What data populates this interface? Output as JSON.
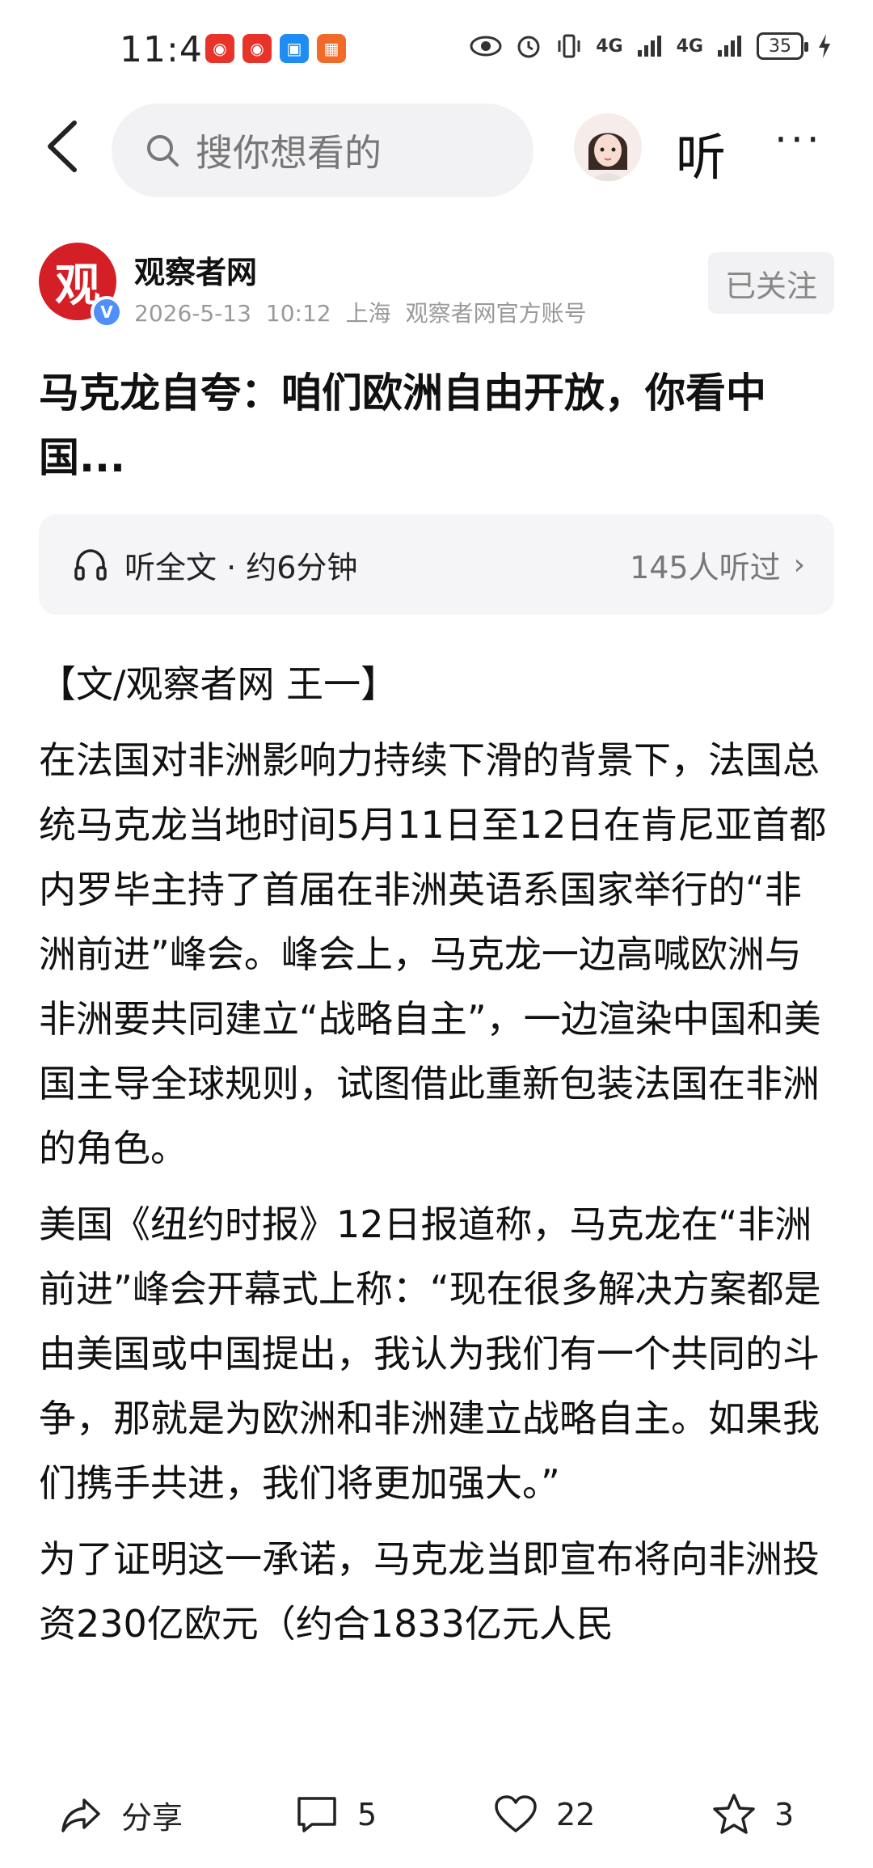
{
  "status_bar": {
    "time": "11:46",
    "signal_1": "4G",
    "signal_2": "4G",
    "battery": "35"
  },
  "top_bar": {
    "search_placeholder": "搜你想看的",
    "listen_label": "听",
    "more_label": "···"
  },
  "author": {
    "logo_char": "观",
    "name": "观察者网",
    "date": "2026-5-13",
    "time": "10:12",
    "location": "上海",
    "account_type": "观察者网官方账号",
    "follow_label": "已关注"
  },
  "article": {
    "title": "马克龙自夸：咱们欧洲自由开放，你看中国...",
    "listen_full": "听全文 · 约6分钟",
    "listen_count": "145人听过",
    "byline": "【文/观察者网 王一】",
    "paragraphs": [
      "在法国对非洲影响力持续下滑的背景下，法国总统马克龙当地时间5月11日至12日在肯尼亚首都内罗毕主持了首届在非洲英语系国家举行的“非洲前进”峰会。峰会上，马克龙一边高喊欧洲与非洲要共同建立“战略自主”，一边渲染中国和美国主导全球规则，试图借此重新包装法国在非洲的角色。",
      "美国《纽约时报》12日报道称，马克龙在“非洲前进”峰会开幕式上称：“现在很多解决方案都是由美国或中国提出，我认为我们有一个共同的斗争，那就是为欧洲和非洲建立战略自主。如果我们携手共进，我们将更加强大。”",
      "为了证明这一承诺，马克龙当即宣布将向非洲投资230亿欧元（约合1833亿元人民"
    ]
  },
  "bottom_bar": {
    "share_label": "分享",
    "comments": "5",
    "likes": "22",
    "favorites": "3"
  }
}
